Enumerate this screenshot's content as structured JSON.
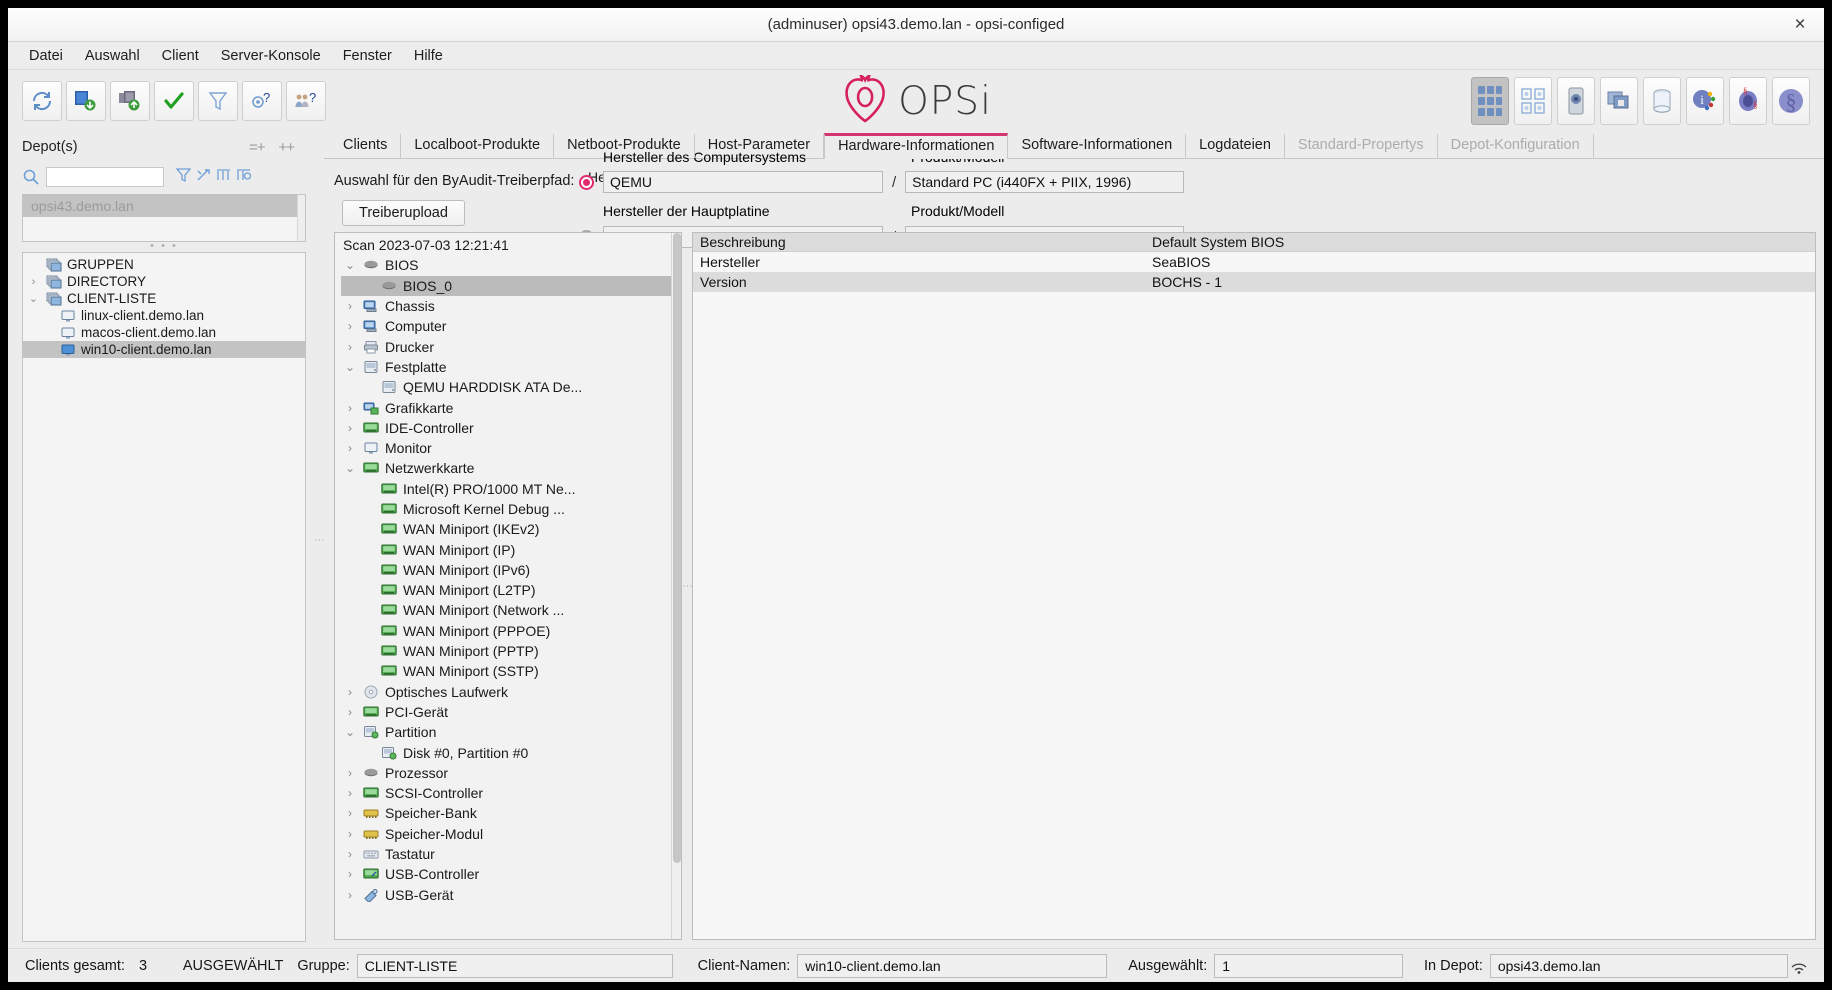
{
  "window": {
    "title": "(adminuser) opsi43.demo.lan - opsi-configed",
    "close_label": "×"
  },
  "menubar": {
    "items": [
      "Datei",
      "Auswahl",
      "Client",
      "Server-Konsole",
      "Fenster",
      "Hilfe"
    ]
  },
  "toolbar": {
    "logo_text": "OPSi",
    "left_buttons": [
      {
        "name": "reload-button",
        "icon": "reload-icon"
      },
      {
        "name": "save-client-button",
        "icon": "client-download-icon"
      },
      {
        "name": "copy-client-button",
        "icon": "client-upload-icon"
      },
      {
        "name": "confirm-button",
        "icon": "check-icon"
      },
      {
        "name": "filter-button",
        "icon": "funnel-icon"
      },
      {
        "name": "client-help-button",
        "icon": "client-question-icon"
      },
      {
        "name": "group-help-button",
        "icon": "group-question-icon"
      }
    ],
    "right_buttons": [
      {
        "name": "clients-grid-button",
        "icon": "clients-grid-icon",
        "selected": true
      },
      {
        "name": "products-view-button",
        "icon": "product-cards-icon",
        "selected": false
      },
      {
        "name": "depot-view-button",
        "icon": "depot-device-icon",
        "selected": false
      },
      {
        "name": "license-view-button",
        "icon": "license-screen-icon",
        "selected": false
      },
      {
        "name": "database-button",
        "icon": "database-icon",
        "selected": false
      },
      {
        "name": "info-button",
        "icon": "info-colorful-icon",
        "selected": false
      },
      {
        "name": "license-pool-button",
        "icon": "license-coin-icon",
        "selected": false
      },
      {
        "name": "legal-button",
        "icon": "paragraph-icon",
        "selected": false
      }
    ]
  },
  "sidebar": {
    "depot_label": "Depot(s)",
    "head_icons": [
      "=+",
      "++"
    ],
    "search_value": "",
    "search_placeholder": "",
    "search_tools": [
      "funnel-icon",
      "reset-filter-icon",
      "columns-icon",
      "select-icon"
    ],
    "depots": [
      {
        "label": "opsi43.demo.lan",
        "selected": true
      }
    ],
    "clients_tree": [
      {
        "label": "GRUPPEN",
        "arrow": "",
        "icon": "group-icon",
        "indent": 1,
        "selected": false
      },
      {
        "label": "DIRECTORY",
        "arrow": "›",
        "icon": "group-icon",
        "indent": 1,
        "selected": false
      },
      {
        "label": "CLIENT-LISTE",
        "arrow": "⌄",
        "icon": "group-icon",
        "indent": 1,
        "selected": false
      },
      {
        "label": "linux-client.demo.lan",
        "arrow": "",
        "icon": "monitor-icon",
        "indent": 2,
        "selected": false
      },
      {
        "label": "macos-client.demo.lan",
        "arrow": "",
        "icon": "monitor-icon",
        "indent": 2,
        "selected": false
      },
      {
        "label": "win10-client.demo.lan",
        "arrow": "",
        "icon": "monitor-blue-icon",
        "indent": 2,
        "selected": true
      }
    ]
  },
  "tabs": [
    {
      "label": "Clients",
      "active": false,
      "disabled": false
    },
    {
      "label": "Localboot-Produkte",
      "active": false,
      "disabled": false
    },
    {
      "label": "Netboot-Produkte",
      "active": false,
      "disabled": false
    },
    {
      "label": "Host-Parameter",
      "active": false,
      "disabled": false
    },
    {
      "label": "Hardware-Informationen",
      "active": true,
      "disabled": false
    },
    {
      "label": "Software-Informationen",
      "active": false,
      "disabled": false
    },
    {
      "label": "Logdateien",
      "active": false,
      "disabled": false
    },
    {
      "label": "Standard-Propertys",
      "active": false,
      "disabled": true
    },
    {
      "label": "Depot-Konfiguration",
      "active": false,
      "disabled": true
    }
  ],
  "driver_path": {
    "label": "Auswahl für den ByAudit-Treiberpfad:",
    "upload_button": "Treiberupload",
    "row1": {
      "radio_selected": true,
      "vendor_caption": "Hersteller des Computersystems",
      "vendor_value": "QEMU",
      "model_caption": "Produkt/Modell",
      "model_value": "Standard PC (i440FX + PIIX, 1996)",
      "separator": "/"
    },
    "row2": {
      "radio_selected": false,
      "vendor_caption": "Hersteller der Hauptplatine",
      "vendor_value": "",
      "model_caption": "Produkt/Modell",
      "model_value": "",
      "separator": "/"
    }
  },
  "hardware_tree": {
    "scan_label": "Scan 2023-07-03 12:21:41",
    "nodes": [
      {
        "label": "BIOS",
        "arrow": "⌄",
        "icon": "chip-icon",
        "indent": 1,
        "selected": false
      },
      {
        "label": "BIOS_0",
        "arrow": "",
        "icon": "chip-icon",
        "indent": 2,
        "selected": true
      },
      {
        "label": "Chassis",
        "arrow": "›",
        "icon": "computer-icon",
        "indent": 1,
        "selected": false
      },
      {
        "label": "Computer",
        "arrow": "›",
        "icon": "computer-icon",
        "indent": 1,
        "selected": false
      },
      {
        "label": "Drucker",
        "arrow": "›",
        "icon": "printer-icon",
        "indent": 1,
        "selected": false
      },
      {
        "label": "Festplatte",
        "arrow": "⌄",
        "icon": "disk-icon",
        "indent": 1,
        "selected": false
      },
      {
        "label": "QEMU HARDDISK ATA De...",
        "arrow": "",
        "icon": "disk-icon",
        "indent": 2,
        "selected": false
      },
      {
        "label": "Grafikkarte",
        "arrow": "›",
        "icon": "gfx-icon",
        "indent": 1,
        "selected": false
      },
      {
        "label": "IDE-Controller",
        "arrow": "›",
        "icon": "card-icon",
        "indent": 1,
        "selected": false
      },
      {
        "label": "Monitor",
        "arrow": "›",
        "icon": "monitor-icon",
        "indent": 1,
        "selected": false
      },
      {
        "label": "Netzwerkkarte",
        "arrow": "⌄",
        "icon": "card-icon",
        "indent": 1,
        "selected": false
      },
      {
        "label": "Intel(R) PRO/1000 MT Ne...",
        "arrow": "",
        "icon": "card-icon",
        "indent": 2,
        "selected": false
      },
      {
        "label": "Microsoft Kernel Debug ...",
        "arrow": "",
        "icon": "card-icon",
        "indent": 2,
        "selected": false
      },
      {
        "label": "WAN Miniport (IKEv2)",
        "arrow": "",
        "icon": "card-icon",
        "indent": 2,
        "selected": false
      },
      {
        "label": "WAN Miniport (IP)",
        "arrow": "",
        "icon": "card-icon",
        "indent": 2,
        "selected": false
      },
      {
        "label": "WAN Miniport (IPv6)",
        "arrow": "",
        "icon": "card-icon",
        "indent": 2,
        "selected": false
      },
      {
        "label": "WAN Miniport (L2TP)",
        "arrow": "",
        "icon": "card-icon",
        "indent": 2,
        "selected": false
      },
      {
        "label": "WAN Miniport (Network ...",
        "arrow": "",
        "icon": "card-icon",
        "indent": 2,
        "selected": false
      },
      {
        "label": "WAN Miniport (PPPOE)",
        "arrow": "",
        "icon": "card-icon",
        "indent": 2,
        "selected": false
      },
      {
        "label": "WAN Miniport (PPTP)",
        "arrow": "",
        "icon": "card-icon",
        "indent": 2,
        "selected": false
      },
      {
        "label": "WAN Miniport (SSTP)",
        "arrow": "",
        "icon": "card-icon",
        "indent": 2,
        "selected": false
      },
      {
        "label": "Optisches Laufwerk",
        "arrow": "›",
        "icon": "cd-icon",
        "indent": 1,
        "selected": false
      },
      {
        "label": "PCI-Gerät",
        "arrow": "›",
        "icon": "card-icon",
        "indent": 1,
        "selected": false
      },
      {
        "label": "Partition",
        "arrow": "⌄",
        "icon": "partition-icon",
        "indent": 1,
        "selected": false
      },
      {
        "label": "Disk #0, Partition #0",
        "arrow": "",
        "icon": "partition-icon",
        "indent": 2,
        "selected": false
      },
      {
        "label": "Prozessor",
        "arrow": "›",
        "icon": "chip-icon",
        "indent": 1,
        "selected": false
      },
      {
        "label": "SCSI-Controller",
        "arrow": "›",
        "icon": "card-icon",
        "indent": 1,
        "selected": false
      },
      {
        "label": "Speicher-Bank",
        "arrow": "›",
        "icon": "memory-icon",
        "indent": 1,
        "selected": false
      },
      {
        "label": "Speicher-Modul",
        "arrow": "›",
        "icon": "memory-icon",
        "indent": 1,
        "selected": false
      },
      {
        "label": "Tastatur",
        "arrow": "›",
        "icon": "keyboard-icon",
        "indent": 1,
        "selected": false
      },
      {
        "label": "USB-Controller",
        "arrow": "›",
        "icon": "usb-card-icon",
        "indent": 1,
        "selected": false
      },
      {
        "label": "USB-Gerät",
        "arrow": "›",
        "icon": "usb-device-icon",
        "indent": 1,
        "selected": false
      }
    ]
  },
  "detail_table": {
    "header": {
      "col1": "Beschreibung",
      "col2": "Default System BIOS"
    },
    "rows": [
      {
        "col1": "Hersteller",
        "col2": "SeaBIOS"
      },
      {
        "col1": "Version",
        "col2": "BOCHS  - 1"
      }
    ]
  },
  "statusbar": {
    "clients_total_label": "Clients gesamt:",
    "clients_total_value": "3",
    "selected_label": "AUSGEWÄHLT",
    "group_label": "Gruppe:",
    "group_value": "CLIENT-LISTE",
    "clientnames_label": "Client-Namen:",
    "clientnames_value": "win10-client.demo.lan",
    "count_label": "Ausgewählt:",
    "count_value": "1",
    "depot_label": "In Depot:",
    "depot_value": "opsi43.demo.lan"
  }
}
